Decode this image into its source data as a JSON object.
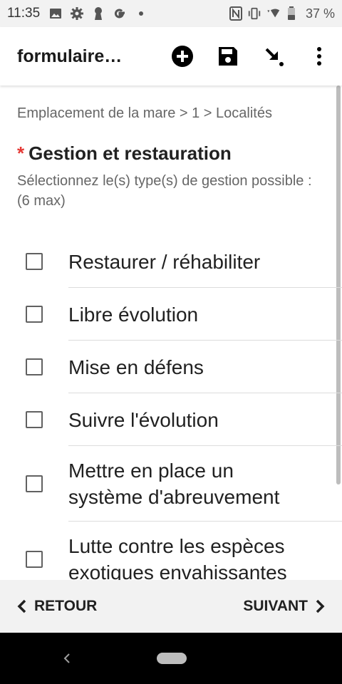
{
  "status_bar": {
    "time": "11:35",
    "battery": "37 %",
    "left_icons": [
      "image-icon",
      "gear-icon",
      "keyhole-icon",
      "google-icon",
      "dot-icon"
    ],
    "right_icons": [
      "nfc-icon",
      "vibrate-icon",
      "wifi-icon",
      "battery-icon"
    ]
  },
  "app_bar": {
    "title": "formulaire…",
    "actions": [
      "add-circle-icon",
      "save-icon",
      "download-arrow-icon",
      "overflow-menu-icon"
    ]
  },
  "content": {
    "breadcrumb": "Emplacement de la mare > 1 > Localités",
    "required_marker": "*",
    "question_title": "Gestion et restauration",
    "hint_line1": "Sélectionnez le(s) type(s) de gestion possible :",
    "hint_line2": "(6 max)",
    "options": [
      {
        "label": "Restaurer / réhabiliter",
        "checked": false
      },
      {
        "label": "Libre évolution",
        "checked": false
      },
      {
        "label": "Mise en défens",
        "checked": false
      },
      {
        "label": "Suivre l'évolution",
        "checked": false
      },
      {
        "label": "Mettre en place un système d'abreuvement",
        "checked": false
      },
      {
        "label": "Lutte contre les espèces exotiques envahissantes",
        "checked": false
      }
    ]
  },
  "bottom_nav": {
    "back_label": "RETOUR",
    "next_label": "SUIVANT"
  },
  "colors": {
    "required": "#e53935",
    "status_bar_bg": "#f2f2f2",
    "system_nav_bg": "#000000"
  }
}
